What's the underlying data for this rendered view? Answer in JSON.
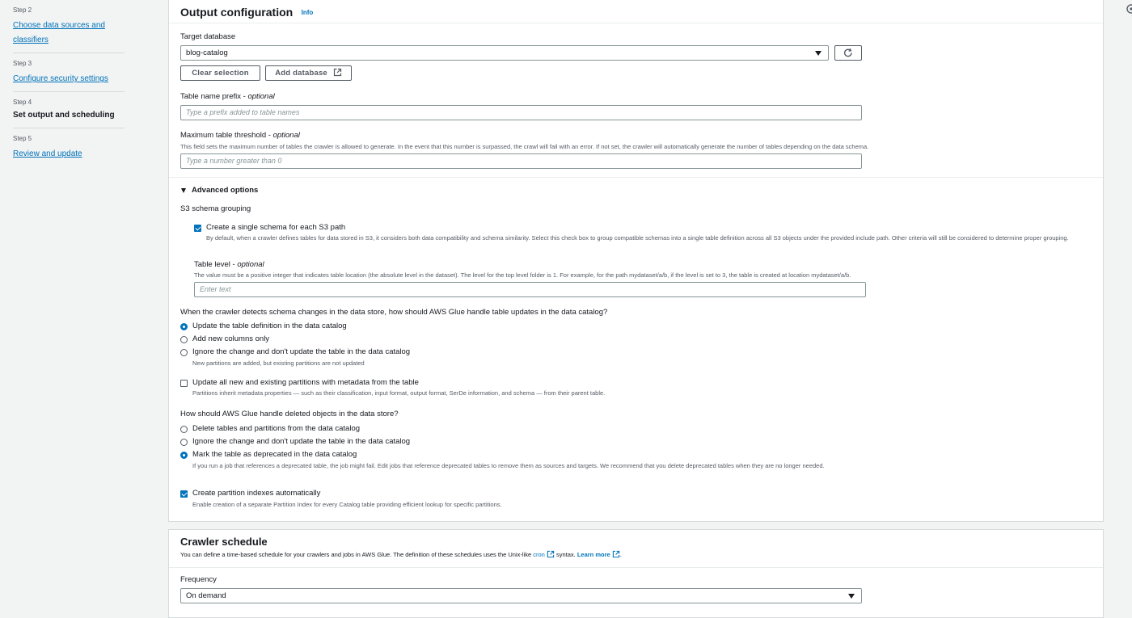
{
  "sidebar": {
    "steps": [
      {
        "num": "Step 2",
        "title": "Choose data sources and classifiers"
      },
      {
        "num": "Step 3",
        "title": "Configure security settings"
      },
      {
        "num": "Step 4",
        "title": "Set output and scheduling"
      },
      {
        "num": "Step 5",
        "title": "Review and update"
      }
    ]
  },
  "output": {
    "title": "Output configuration",
    "info": "Info",
    "target_db_label": "Target database",
    "target_db_value": "blog-catalog",
    "clear_selection": "Clear selection",
    "add_database": "Add database",
    "prefix_label": "Table name prefix - ",
    "prefix_optional": "optional",
    "prefix_placeholder": "Type a prefix added to table names",
    "threshold_label": "Maximum table threshold - ",
    "threshold_optional": "optional",
    "threshold_desc": "This field sets the maximum number of tables the crawler is allowed to generate. In the event that this number is surpassed, the crawl will fail with an error. If not set, the crawler will automatically generate the number of tables depending on the data schema.",
    "threshold_placeholder": "Type a number greater than 0",
    "advanced_label": "Advanced options",
    "s3_grouping_label": "S3 schema grouping",
    "single_schema_label": "Create a single schema for each S3 path",
    "single_schema_desc": "By default, when a crawler defines tables for data stored in S3, it considers both data compatibility and schema similarity. Select this check box to group compatible schemas into a single table definition across all S3 objects under the provided include path. Other criteria will still be considered to determine proper grouping.",
    "table_level_label": "Table level - ",
    "table_level_optional": "optional",
    "table_level_desc": "The value must be a positive integer that indicates table location (the absolute level in the dataset). The level for the top level folder is 1. For example, for the path mydataset/a/b, if the level is set to 3, the table is created at location mydataset/a/b.",
    "table_level_placeholder": "Enter text",
    "schema_change_question": "When the crawler detects schema changes in the data store, how should AWS Glue handle table updates in the data catalog?",
    "schema_change_options": [
      {
        "label": "Update the table definition in the data catalog",
        "desc": ""
      },
      {
        "label": "Add new columns only",
        "desc": ""
      },
      {
        "label": "Ignore the change and don't update the table in the data catalog",
        "desc": "New partitions are added, but existing partitions are not updated"
      }
    ],
    "update_partitions_label": "Update all new and existing partitions with metadata from the table",
    "update_partitions_desc": "Partitions inherit metadata properties — such as their classification, input format, output format, SerDe information, and schema — from their parent table.",
    "deleted_question": "How should AWS Glue handle deleted objects in the data store?",
    "deleted_options": [
      {
        "label": "Delete tables and partitions from the data catalog",
        "desc": ""
      },
      {
        "label": "Ignore the change and don't update the table in the data catalog",
        "desc": ""
      },
      {
        "label": "Mark the table as deprecated in the data catalog",
        "desc": "If you run a job that references a deprecated table, the job might fail. Edit jobs that reference deprecated tables to remove them as sources and targets. We recommend that you delete deprecated tables when they are no longer needed."
      }
    ],
    "partition_index_label": "Create partition indexes automatically",
    "partition_index_desc": "Enable creation of a separate Partition Index for every Catalog table providing efficient lookup for specific partitions."
  },
  "schedule": {
    "title": "Crawler schedule",
    "desc_pre": "You can define a time-based schedule for your crawlers and jobs in AWS Glue. The definition of these schedules uses the Unix-like ",
    "cron": "cron",
    "desc_mid": " syntax. ",
    "learn_more": "Learn more",
    "desc_end": ".",
    "frequency_label": "Frequency",
    "frequency_value": "On demand"
  },
  "colors": {
    "accent": "#0073bb",
    "border": "#d5dbdb",
    "text": "#16191f",
    "muted": "#545b64"
  }
}
